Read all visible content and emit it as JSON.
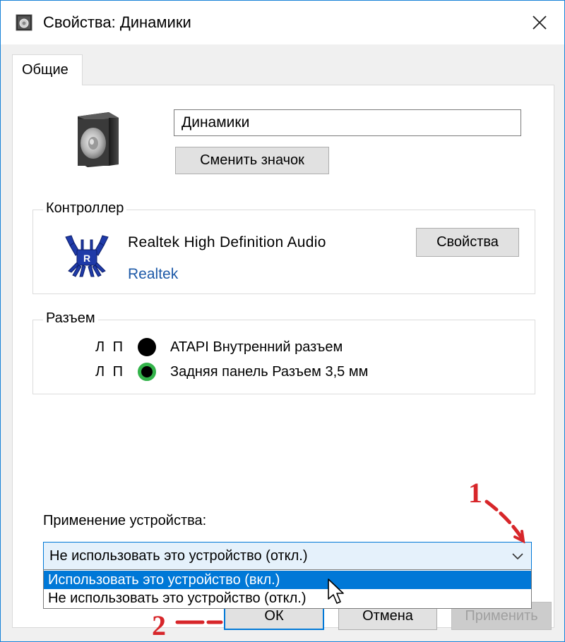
{
  "window": {
    "title": "Свойства: Динамики"
  },
  "tabs": [
    {
      "label": "Общие"
    }
  ],
  "general": {
    "device_name_value": "Динамики",
    "change_icon_label": "Сменить значок"
  },
  "controller": {
    "group_label": "Контроллер",
    "driver_name": "Realtek High Definition Audio",
    "vendor": "Realtek",
    "properties_label": "Свойства"
  },
  "jack": {
    "group_label": "Разъем",
    "rows": [
      {
        "lr": "Л П",
        "name": "ATAPI Внутренний разъем",
        "color": "#000000"
      },
      {
        "lr": "Л П",
        "name": "Задняя панель Разъем 3,5 мм",
        "color": "#33b34a"
      }
    ]
  },
  "usage": {
    "label": "Применение устройства:",
    "selected_value": "Не использовать это устройство (откл.)",
    "options": [
      "Использовать это устройство (вкл.)",
      "Не использовать это устройство (откл.)"
    ]
  },
  "buttons": {
    "ok": "ОК",
    "cancel": "Отмена",
    "apply": "Применить"
  },
  "annotations": {
    "marker_1": "1",
    "marker_2": "2"
  },
  "colors": {
    "accent": "#0078d7",
    "annotation_red": "#d7262a",
    "link_blue": "#1e5aa8"
  },
  "icons": {
    "title": "speaker-small-icon",
    "device": "speaker-icon",
    "vendor": "realtek-crab-logo",
    "close": "close-icon",
    "dropdown": "chevron-down-icon",
    "pointer": "mouse-cursor-icon"
  }
}
